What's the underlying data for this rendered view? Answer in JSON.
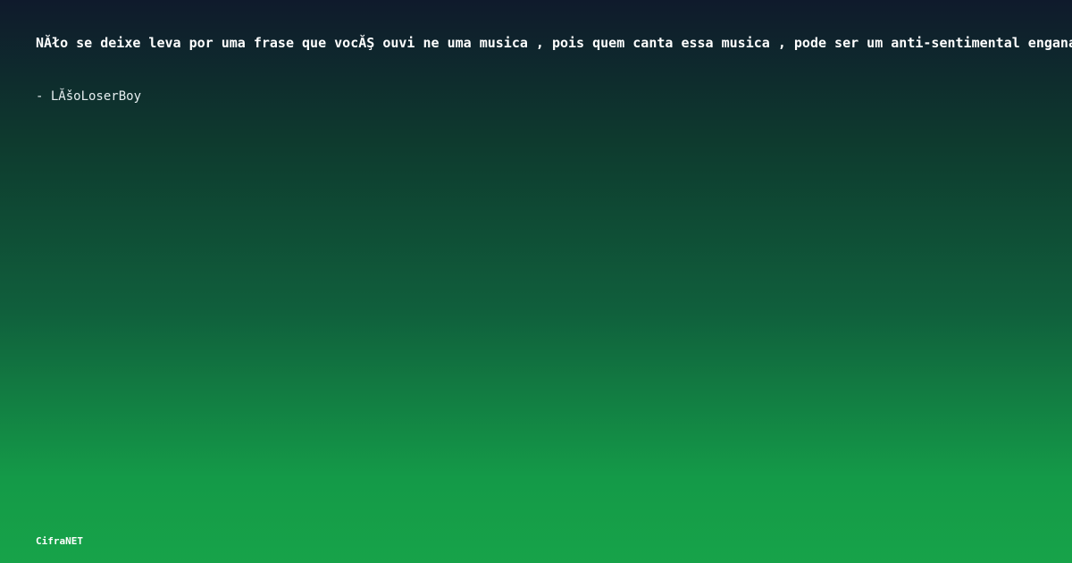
{
  "quote": {
    "text": "NĂło se deixe leva por uma frase que vocĂŞ ouvi ne uma musica , pois quem canta essa musica , pode ser um anti-sentimental enganado."
  },
  "author": {
    "text": "- LĂšoLoserBoy"
  },
  "brand": {
    "name": "CifraNET"
  },
  "colors": {
    "gradient_top": "#0f1a2c",
    "gradient_bottom": "#17a349",
    "text": "#ffffff"
  }
}
